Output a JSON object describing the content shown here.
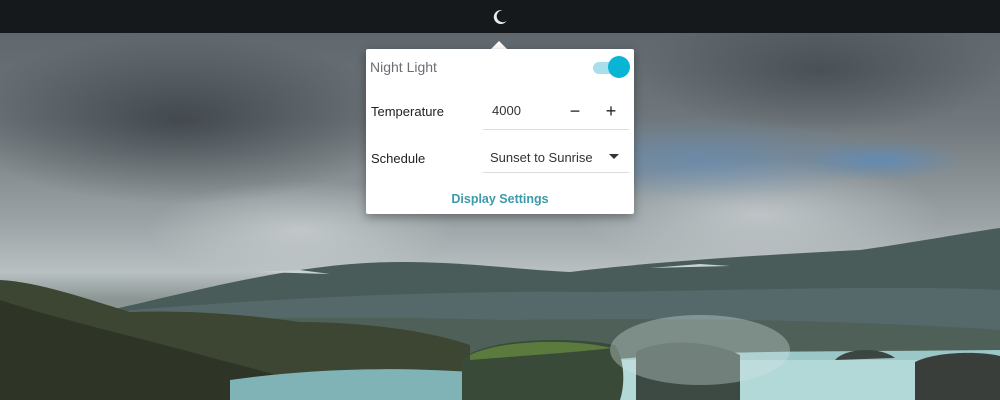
{
  "panel": {
    "indicator_icon": "moon-icon"
  },
  "night_light": {
    "title": "Night Light",
    "enabled": true,
    "accent_color": "#0ab4d4",
    "temperature": {
      "label": "Temperature",
      "value": "4000",
      "decrease_symbol": "−",
      "increase_symbol": "+"
    },
    "schedule": {
      "label": "Schedule",
      "selected": "Sunset to Sunrise"
    },
    "display_settings_label": "Display Settings"
  }
}
